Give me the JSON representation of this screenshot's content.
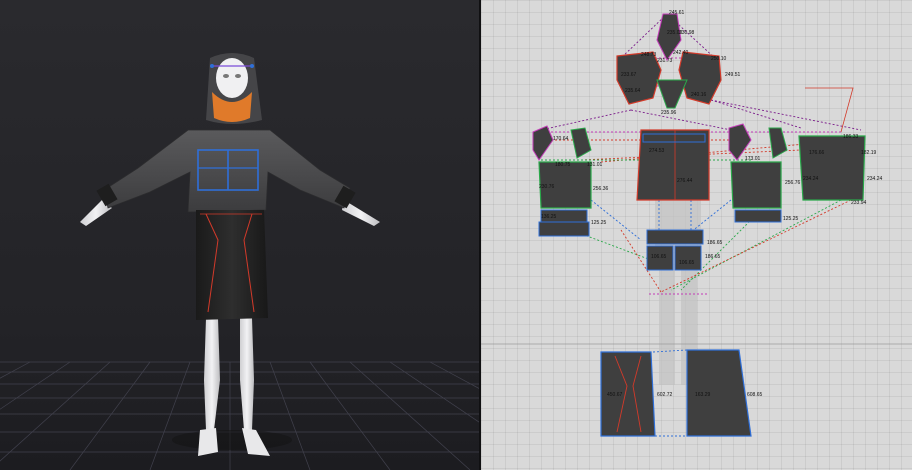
{
  "colors": {
    "viewport_bg": "#26262a",
    "floor_grid": "#4a4a58",
    "pattern_bg": "#d9d9d9",
    "panel_fill": "#3f3f3f",
    "seam_blue": "#2f6fd8",
    "seam_red": "#d23a2a",
    "seam_green": "#2aa84a",
    "seam_magenta": "#c33bb8",
    "hood_orange": "#e07a2a"
  },
  "icons": {
    "avatar": "avatar-icon"
  },
  "measurements": {
    "hood": [
      "245.61",
      "235.05",
      "230.98",
      "248.73",
      "242.40",
      "231.73",
      "250.10",
      "249.51",
      "233.67",
      "235.64",
      "240.16",
      "235.96"
    ],
    "bodice": [
      "170.64",
      "180.75",
      "230.76",
      "256.36",
      "131.01",
      "274.53",
      "276.44",
      "173.01",
      "256.76",
      "234.24",
      "234.24",
      "182.19",
      "186.33",
      "176.66"
    ],
    "sleeves": [
      "136.25",
      "125.25",
      "125.25",
      "106.65",
      "106.65",
      "233.94"
    ],
    "waistband": [
      "186.65",
      "186.65"
    ],
    "skirt": [
      "602.72",
      "608.65",
      "450.67",
      "163.29"
    ]
  }
}
